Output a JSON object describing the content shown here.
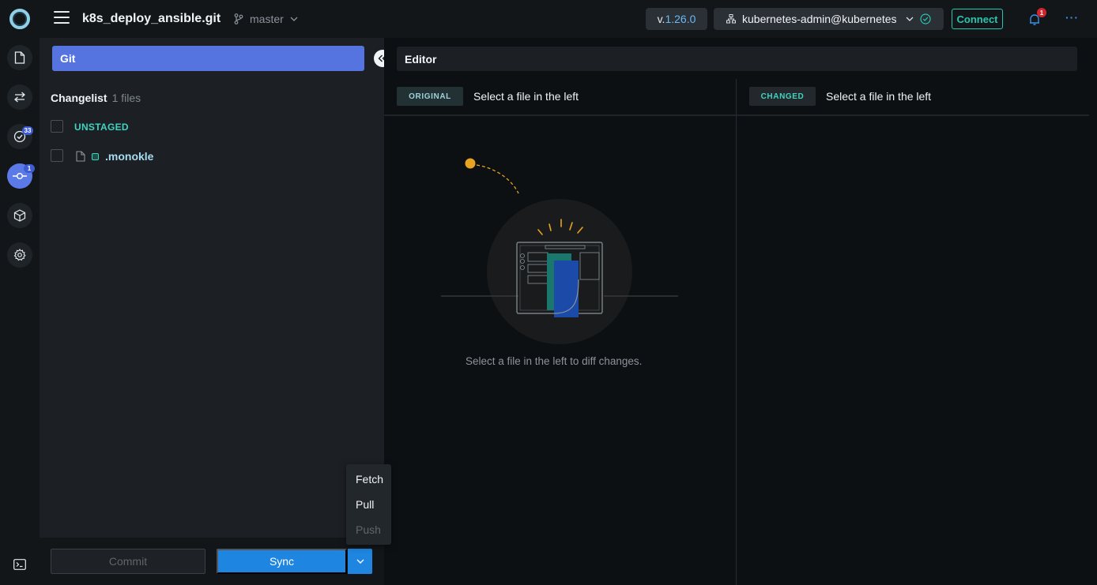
{
  "topbar": {
    "project_name": "k8s_deploy_ansible.git",
    "branch": "master",
    "version_prefix": "v.",
    "version_number": "1.26.0",
    "context": "kubernetes-admin@kubernetes",
    "connect_label": "Connect",
    "notification_count": "1",
    "more_label": "···"
  },
  "rail": {
    "validation_count": "33",
    "git_count": "1"
  },
  "git_panel": {
    "title": "Git",
    "changelist_label": "Changelist",
    "file_count": "1 files",
    "unstaged_label": "UNSTAGED",
    "file_name": ".monokle",
    "commit_label": "Commit",
    "sync_label": "Sync"
  },
  "sync_menu": {
    "fetch": "Fetch",
    "pull": "Pull",
    "push": "Push"
  },
  "editor": {
    "title": "Editor",
    "original_tag": "ORIGINAL",
    "original_text": "Select a file in the left",
    "changed_tag": "CHANGED",
    "changed_text": "Select a file in the left",
    "empty_message": "Select a file in the left to diff changes."
  },
  "colors": {
    "accent_blue": "#5574e0",
    "sync_blue": "#1e86e0",
    "teal": "#3fd3c2",
    "alert_red": "#d3262c"
  }
}
